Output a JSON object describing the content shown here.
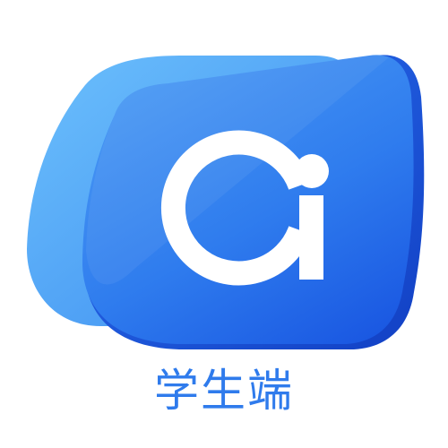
{
  "app_icon": {
    "icon_name": "ai-logo-icon",
    "colors": {
      "back_card_light": "#5fb6fb",
      "back_card_dark": "#3d8ef0",
      "front_card_light": "#3f8ff2",
      "front_card_dark": "#1b5fe6",
      "edge_shade": "#1446c9",
      "glyph": "#ffffff"
    }
  },
  "caption": {
    "text": "学生端",
    "color": "#2f7bec"
  }
}
